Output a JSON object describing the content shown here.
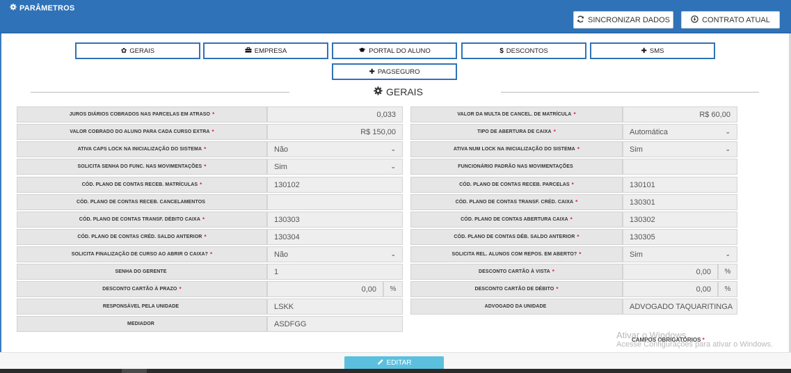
{
  "header": {
    "title": "PARÂMETROS",
    "sync_label": "SINCRONIZAR DADOS",
    "contract_label": "CONTRATO ATUAL"
  },
  "tabs": [
    {
      "label": "GERAIS",
      "icon": "gear-icon"
    },
    {
      "label": "EMPRESA",
      "icon": "briefcase-icon"
    },
    {
      "label": "PORTAL DO ALUNO",
      "icon": "graduation-cap-icon"
    },
    {
      "label": "DESCONTOS",
      "icon": "dollar-icon"
    },
    {
      "label": "SMS",
      "icon": "plus-icon"
    },
    {
      "label": "PAGSEGURO",
      "icon": "plus-icon"
    }
  ],
  "section": {
    "title": "GERAIS"
  },
  "left": [
    {
      "label": "JUROS DIÁRIOS COBRADOS NAS PARCELAS EM ATRASO",
      "req": "*",
      "value": "0,033"
    },
    {
      "label": "VALOR COBRADO DO ALUNO PARA CADA CURSO EXTRA",
      "req": "*",
      "value": "R$ 150,00"
    },
    {
      "label": "ATIVA CAPS LOCK NA INICIALIZAÇÃO DO SISTEMA",
      "req": "*",
      "value": "Não"
    },
    {
      "label": "SOLICITA SENHA DO FUNC. NAS MOVIMENTAÇÕES",
      "req": "*",
      "value": "Sim"
    },
    {
      "label": "CÓD. PLANO DE CONTAS RECEB. MATRÍCULAS",
      "req": "*",
      "value": "130102"
    },
    {
      "label": "CÓD. PLANO DE CONTAS RECEB. CANCELAMENTOS",
      "req": "",
      "value": ""
    },
    {
      "label": "CÓD. PLANO DE CONTAS TRANSF. DÉBITO CAIXA",
      "req": "*",
      "value": "130303"
    },
    {
      "label": "CÓD. PLANO DE CONTAS CRÉD. SALDO ANTERIOR",
      "req": "*",
      "value": "130304"
    },
    {
      "label": "SOLICITA FINALIZAÇÃO DE CURSO AO ABRIR O CAIXA?",
      "req": "*",
      "value": "Não"
    },
    {
      "label": "SENHA DO GERENTE",
      "req": "",
      "value": "1"
    },
    {
      "label": "DESCONTO CARTÃO À PRAZO",
      "req": "*",
      "value": "0,00",
      "addon": "%"
    },
    {
      "label": "RESPONSÁVEL PELA UNIDADE",
      "req": "",
      "value": "LSKK"
    },
    {
      "label": "MEDIADOR",
      "req": "",
      "value": "ASDFGG"
    }
  ],
  "right": [
    {
      "label": "VALOR DA MULTA DE CANCEL. DE MATRÍCULA",
      "req": "*",
      "value": "R$ 60,00"
    },
    {
      "label": "TIPO DE ABERTURA DE CAIXA",
      "req": "*",
      "value": "Automática"
    },
    {
      "label": "ATIVA NUM LOCK NA INICIALIZAÇÃO DO SISTEMA",
      "req": "*",
      "value": "Sim"
    },
    {
      "label": "FUNCIONÁRIO PADRÃO NAS MOVIMENTAÇÕES",
      "req": "",
      "value": ""
    },
    {
      "label": "CÓD. PLANO DE CONTAS RECEB. PARCELAS",
      "req": "*",
      "value": "130101"
    },
    {
      "label": "CÓD. PLANO DE CONTAS TRANSF. CRÉD. CAIXA",
      "req": "*",
      "value": "130301"
    },
    {
      "label": "CÓD. PLANO DE CONTAS ABERTURA CAIXA",
      "req": "*",
      "value": "130302"
    },
    {
      "label": "CÓD. PLANO DE CONTAS DÉB. SALDO ANTERIOR",
      "req": "*",
      "value": "130305"
    },
    {
      "label": "SOLICITA REL. ALUNOS COM REPOS. EM ABERTO?",
      "req": "*",
      "value": "Sim"
    },
    {
      "label": "DESCONTO CARTÃO À VISTA",
      "req": "*",
      "value": "0,00",
      "addon": "%"
    },
    {
      "label": "DESCONTO CARTÃO DE DÉBITO",
      "req": "*",
      "value": "0,00",
      "addon": "%"
    },
    {
      "label": "ADVOGADO DA UNIDADE",
      "req": "",
      "value": "ADVOGADO TAQUARITINGA"
    }
  ],
  "required_note": {
    "text": "CAMPOS OBRIGATÓRIOS",
    "req": "*"
  },
  "watermark": {
    "line1": "Ativar o Windows",
    "line2": "Acesse Configurações para ativar o Windows."
  },
  "footer": {
    "edit_label": "EDITAR"
  },
  "colors": {
    "header": "#2f72b8",
    "tab_border": "#2f72b8",
    "edit_button": "#5bc0de",
    "required": "#d9263b"
  }
}
